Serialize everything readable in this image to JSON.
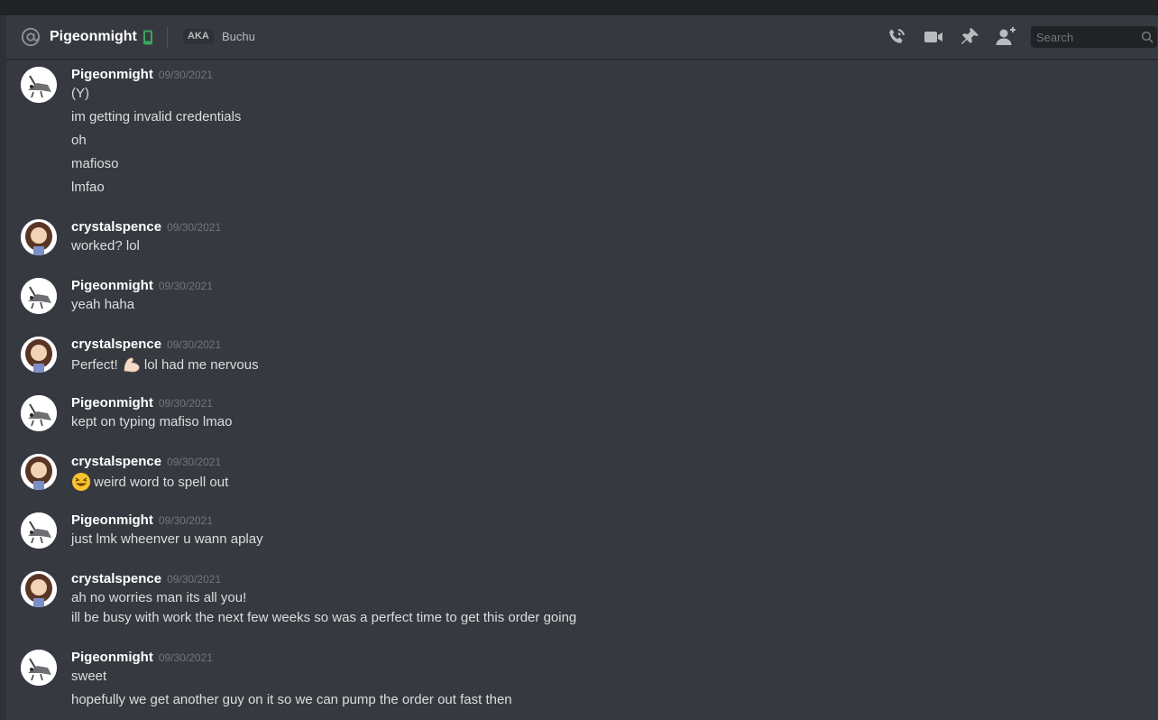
{
  "header": {
    "channel_name": "Pigeonmight",
    "aka_label": "AKA",
    "aka_name": "Buchu",
    "search_placeholder": "Search",
    "icons": [
      "at-icon",
      "mobile-status-icon",
      "voice-call-icon",
      "video-call-icon",
      "pin-icon",
      "add-friend-icon",
      "search-icon"
    ]
  },
  "colors": {
    "background": "#36393f",
    "header_text": "#ffffff",
    "message_text": "#dcddde",
    "timestamp": "#72767d",
    "online_mobile": "#3ba55d"
  },
  "messages": [
    {
      "author": "Pigeonmight",
      "timestamp": "09/30/2021",
      "lines": [
        "(Y)",
        "im getting invalid credentials",
        "oh",
        "mafioso",
        "lmfao"
      ]
    },
    {
      "author": "crystalspence",
      "timestamp": "09/30/2021",
      "lines": [
        "worked? lol"
      ]
    },
    {
      "author": "Pigeonmight",
      "timestamp": "09/30/2021",
      "lines": [
        "yeah haha"
      ]
    },
    {
      "author": "crystalspence",
      "timestamp": "09/30/2021",
      "lines": [
        "Perfect!",
        "lol had me nervous"
      ]
    },
    {
      "author": "Pigeonmight",
      "timestamp": "09/30/2021",
      "lines": [
        "kept on typing mafiso lmao"
      ]
    },
    {
      "author": "crystalspence",
      "timestamp": "09/30/2021",
      "lines": [
        "weird word to spell out"
      ]
    },
    {
      "author": "Pigeonmight",
      "timestamp": "09/30/2021",
      "lines": [
        "just lmk wheenver u wann aplay"
      ]
    },
    {
      "author": "crystalspence",
      "timestamp": "09/30/2021",
      "lines": [
        "ah no worries man its all you!",
        "ill be busy with work the next few weeks so was a perfect time to get this order going"
      ]
    },
    {
      "author": "Pigeonmight",
      "timestamp": "09/30/2021",
      "lines": [
        "sweet",
        "hopefully we get another guy on it so we can pump the order out fast then"
      ]
    }
  ]
}
